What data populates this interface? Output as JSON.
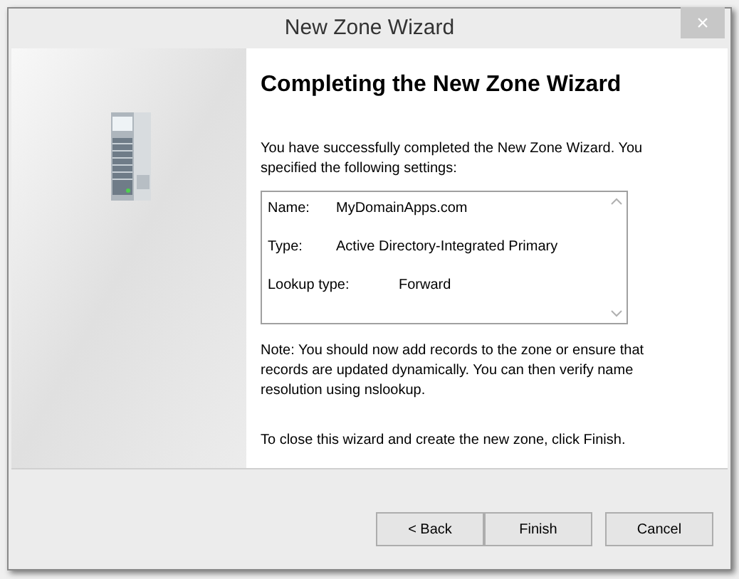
{
  "window": {
    "title": "New Zone Wizard",
    "close": "×"
  },
  "heading": "Completing the New Zone Wizard",
  "intro": "You have successfully completed the New Zone Wizard. You specified the following settings:",
  "settings": [
    {
      "label": "Name:",
      "value": "MyDomainApps.com",
      "kind": "short"
    },
    {
      "label": "Type:",
      "value": "Active Directory-Integrated Primary",
      "kind": "short"
    },
    {
      "label": "Lookup type:",
      "value": "Forward",
      "kind": "long"
    }
  ],
  "note": "Note: You should now add records to the zone or ensure that records are updated dynamically. You can then verify name resolution using nslookup.",
  "closing": "To close this wizard and create the new zone, click Finish.",
  "buttons": [
    "< Back",
    "Finish",
    "Cancel"
  ]
}
